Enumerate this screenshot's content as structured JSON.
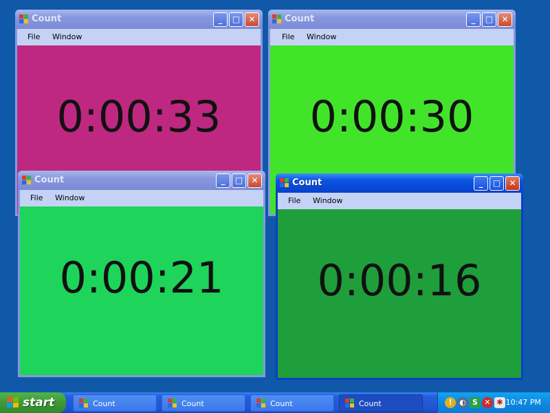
{
  "menu": {
    "file": "File",
    "window": "Window"
  },
  "windows": [
    {
      "title": "Count",
      "time": "0:00:33",
      "color": "#be2880"
    },
    {
      "title": "Count",
      "time": "0:00:30",
      "color": "#42e42a"
    },
    {
      "title": "Count",
      "time": "0:00:21",
      "color": "#1ed45a"
    },
    {
      "title": "Count",
      "time": "0:00:16",
      "color": "#1f9e3c",
      "active": true
    }
  ],
  "window_buttons": {
    "minimize": "_",
    "maximize": "□",
    "close": "✕"
  },
  "taskbar": {
    "start_label": "start",
    "tasks": [
      {
        "label": "Count"
      },
      {
        "label": "Count"
      },
      {
        "label": "Count"
      },
      {
        "label": "Count",
        "active": true
      }
    ],
    "clock": "10:47 PM"
  }
}
